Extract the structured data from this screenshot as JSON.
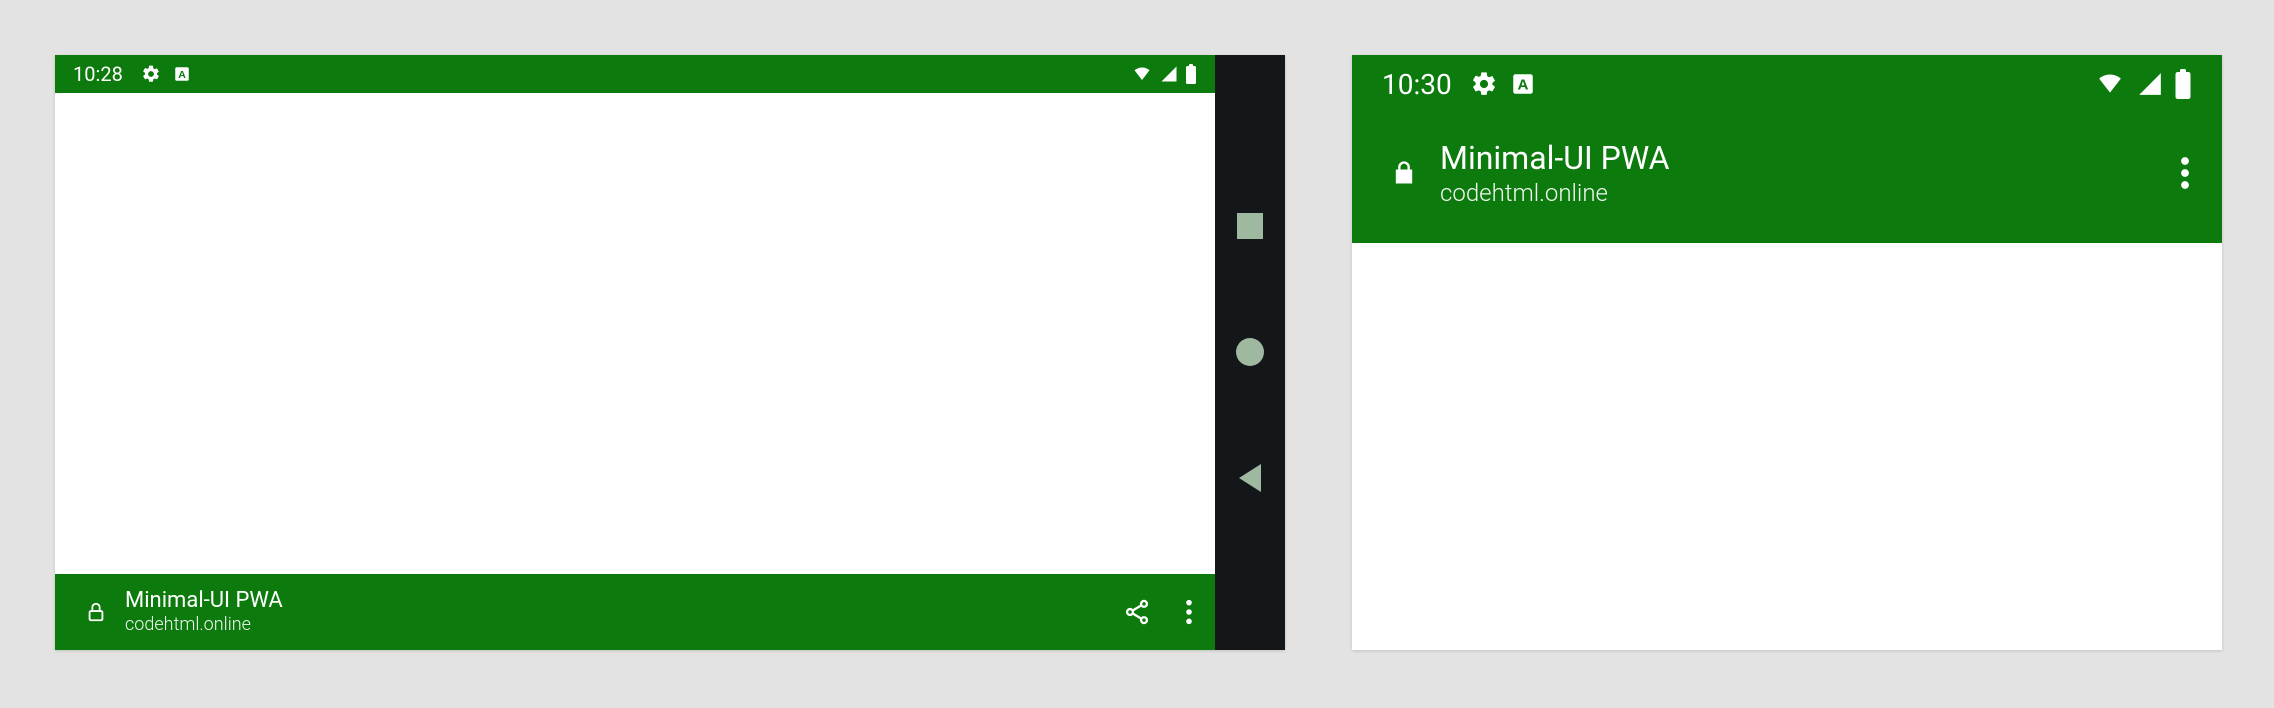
{
  "colors": {
    "brand_green": "#0c7a0c",
    "nav_bg": "#14171a",
    "nav_icon": "#9fb8a0"
  },
  "left": {
    "status": {
      "time": "10:28"
    },
    "app": {
      "title": "Minimal-UI PWA",
      "subtitle": "codehtml.online"
    }
  },
  "right": {
    "status": {
      "time": "10:30"
    },
    "app": {
      "title": "Minimal-UI PWA",
      "subtitle": "codehtml.online"
    }
  }
}
